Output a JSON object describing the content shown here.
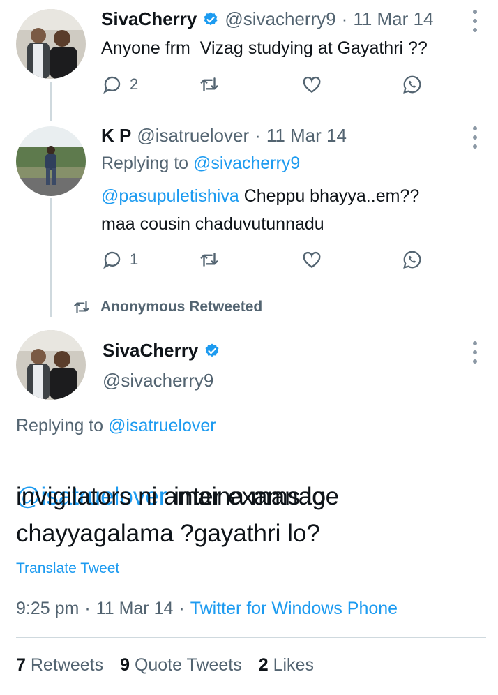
{
  "tweet1": {
    "name": "SivaCherry",
    "handle": "@sivacherry9",
    "dot": "·",
    "date": "11 Mar 14",
    "text": "Anyone frm  Vizag studying at Gayathri ??",
    "reply_count": "2",
    "icons": [
      "verified-badge-icon",
      "reply-icon",
      "retweet-icon",
      "like-icon",
      "whatsapp-icon",
      "more-icon"
    ]
  },
  "tweet2": {
    "name": "K P",
    "handle": "@isatruelover",
    "dot": "·",
    "date": "11 Mar 14",
    "replying_prefix": "Replying to",
    "replying_handle": "@sivacherry9",
    "mention": "@pasupuletishiva",
    "text_line1": " Cheppu bhayya..em??",
    "text_line2": "maa cousin chaduvutunnadu",
    "reply_count": "1"
  },
  "retweet_context": {
    "label": "Anonymous Retweeted"
  },
  "main_tweet": {
    "name": "SivaCherry",
    "handle": "@sivacherry9",
    "replying_prefix": "Replying to",
    "replying_handle": "@isatruelover",
    "mention": "@isatruelover",
    "text_part1": " inter exams lo",
    "text_line2": "invigilators ni amaina manage",
    "text_line3": "chayyagalama ?gayathri lo?",
    "translate_label": "Translate Tweet",
    "time": "9:25 pm",
    "dot1": "·",
    "date": "11 Mar 14",
    "dot2": "·",
    "source": "Twitter for Windows Phone"
  },
  "stats": {
    "retweets_count": "7",
    "retweets_label": "Retweets",
    "quotes_count": "9",
    "quotes_label": "Quote Tweets",
    "likes_count": "2",
    "likes_label": "Likes"
  },
  "colors": {
    "accent": "#1d9bf0",
    "muted": "#536471",
    "text": "#0f1419",
    "thread_line": "#cfd9de"
  }
}
